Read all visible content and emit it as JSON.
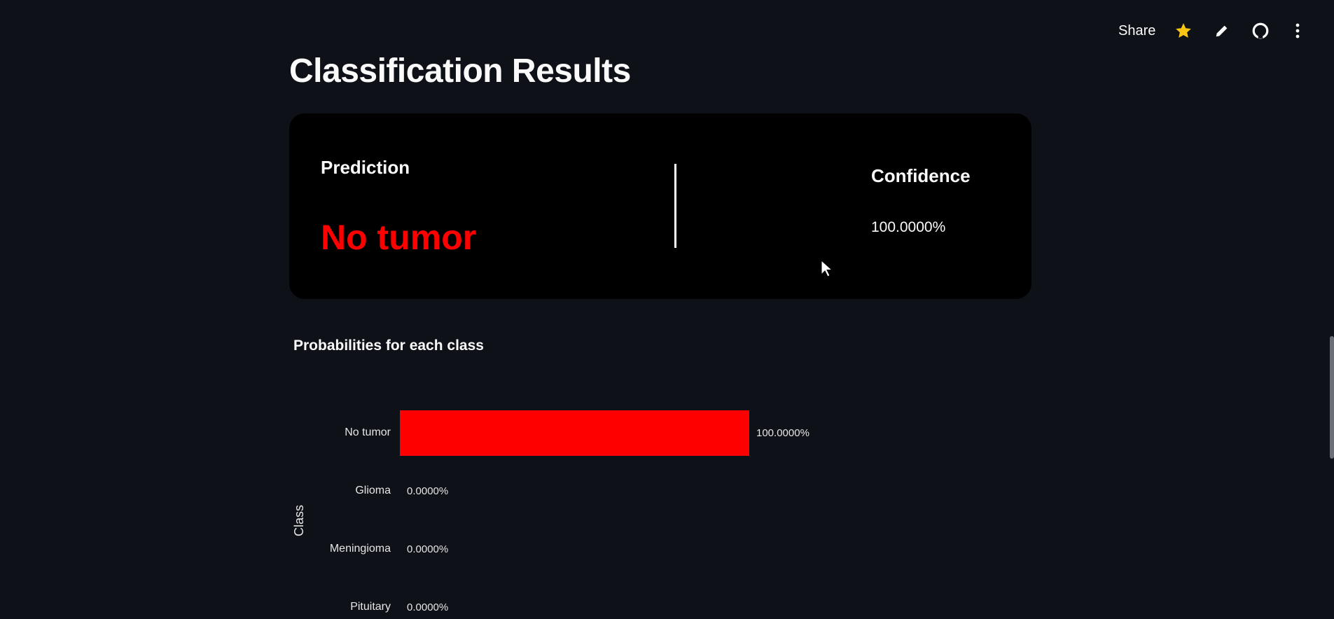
{
  "toolbar": {
    "share_label": "Share",
    "icons": [
      "star-icon",
      "pencil-icon",
      "github-icon",
      "more-vertical-icon"
    ],
    "star_color": "#f9c513"
  },
  "page": {
    "title": "Classification Results"
  },
  "result_card": {
    "prediction_label": "Prediction",
    "prediction_value": "No tumor",
    "prediction_color": "#ff0000",
    "confidence_label": "Confidence",
    "confidence_value": "100.0000%"
  },
  "chart_data": {
    "type": "bar",
    "orientation": "horizontal",
    "title": "Probabilities for each class",
    "ylabel": "Class",
    "xlabel": "",
    "categories": [
      "No tumor",
      "Glioma",
      "Meningioma",
      "Pituitary"
    ],
    "values": [
      100.0,
      0.0,
      0.0,
      0.0
    ],
    "data_labels": [
      "100.0000%",
      "0.0000%",
      "0.0000%",
      "0.0000%"
    ],
    "xlim": [
      0,
      100
    ],
    "bar_color": "#ff0000",
    "grid": false
  }
}
